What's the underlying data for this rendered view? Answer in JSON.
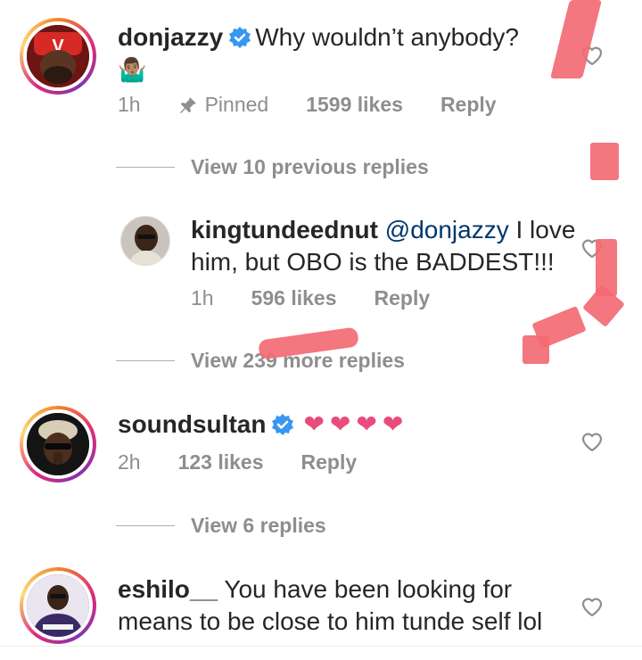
{
  "comments": [
    {
      "username": "donjazzy",
      "text": "Why wouldn’t  anybody?",
      "emoji_line": "🤷🏽‍♂",
      "time": "1h",
      "pinned": "Pinned",
      "likes": "1599 likes",
      "reply": "Reply",
      "view_replies": "View 10 previous replies"
    },
    {
      "username": "kingtundeednut",
      "mention": "@donjazzy",
      "text_line1": "I love",
      "text_line2": "him, but OBO is the BADDEST!!!",
      "time": "1h",
      "likes": "596 likes",
      "reply": "Reply",
      "view_replies": "View 239 more replies"
    },
    {
      "username": "soundsultan",
      "text": "❤❤❤❤",
      "time": "2h",
      "likes": "123 likes",
      "reply": "Reply",
      "view_replies": "View 6 replies"
    },
    {
      "username": "eshilo__",
      "text_line1": "You have been looking for",
      "text_line2": "means to be close to him tunde self lol"
    }
  ],
  "colors": {
    "verified_blue": "#3897f0",
    "heart_pink": "#e84c7d",
    "meta_gray": "#8e8e8e",
    "mention_blue": "#00376b",
    "scribble_red": "#f36a73"
  },
  "icons": [
    "verified-badge-icon",
    "pin-icon",
    "heart-outline-icon"
  ]
}
